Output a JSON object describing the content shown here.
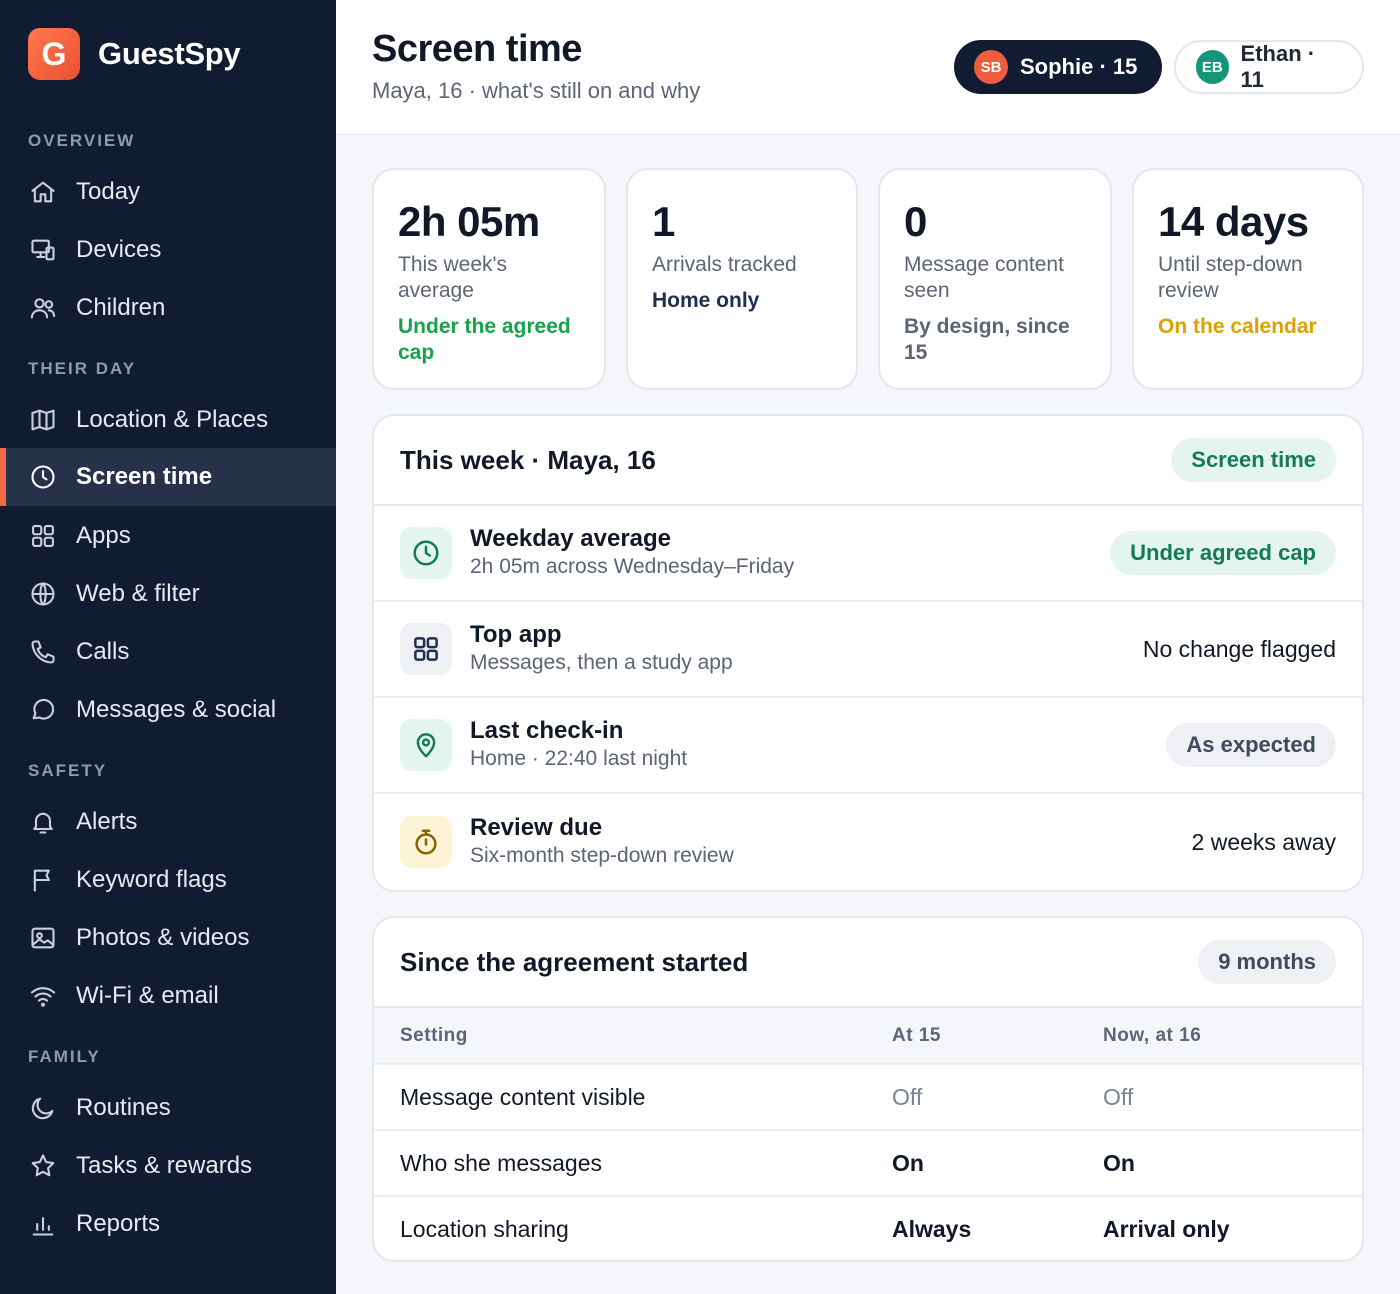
{
  "app": {
    "logo_letter": "G",
    "name": "GuestSpy",
    "accent": "#f26b45"
  },
  "nav": {
    "sections": [
      "OVERVIEW",
      "THEIR DAY",
      "SAFETY",
      "FAMILY"
    ],
    "items": [
      {
        "label": "Today",
        "icon": "home-icon"
      },
      {
        "label": "Devices",
        "icon": "devices-icon"
      },
      {
        "label": "Children",
        "icon": "users-icon"
      },
      {
        "label": "Location & Places",
        "icon": "map-icon"
      },
      {
        "label": "Screen time",
        "icon": "clock-icon",
        "active": true
      },
      {
        "label": "Apps",
        "icon": "apps-icon"
      },
      {
        "label": "Web & filter",
        "icon": "globe-icon"
      },
      {
        "label": "Calls",
        "icon": "phone-icon"
      },
      {
        "label": "Messages & social",
        "icon": "chat-icon"
      },
      {
        "label": "Alerts",
        "icon": "bell-icon"
      },
      {
        "label": "Keyword flags",
        "icon": "flag-icon"
      },
      {
        "label": "Photos & videos",
        "icon": "image-icon"
      },
      {
        "label": "Wi-Fi & email",
        "icon": "wifi-icon"
      },
      {
        "label": "Routines",
        "icon": "moon-icon"
      },
      {
        "label": "Tasks & rewards",
        "icon": "star-icon"
      },
      {
        "label": "Reports",
        "icon": "bar-chart-icon"
      }
    ]
  },
  "header": {
    "title": "Screen time",
    "subtitle": "Maya, 16 · what's still on and why",
    "children": [
      {
        "initials": "SB",
        "label": "Sophie · 15",
        "selected": true
      },
      {
        "initials": "EB",
        "label": "Ethan · 11",
        "selected": false
      }
    ]
  },
  "stats": [
    {
      "value": "2h 05m",
      "label": "This week's average",
      "note": "Under the agreed cap",
      "note_color": "#16a34a"
    },
    {
      "value": "1",
      "label": "Arrivals tracked",
      "note": "Home only",
      "note_color": "#1f2f4d"
    },
    {
      "value": "0",
      "label": "Message content seen",
      "note": "By design, since 15",
      "note_color": "#5b6577"
    },
    {
      "value": "14 days",
      "label": "Until step-down review",
      "note": "On the calendar",
      "note_color": "#e0a100"
    }
  ],
  "week": {
    "title": "This week · Maya, 16",
    "tag": "Screen time",
    "rows": [
      {
        "icon": "clock-icon",
        "title": "Weekday average",
        "sub": "2h 05m across Wednesday–Friday",
        "right": "Under agreed cap",
        "right_style": "green-badge"
      },
      {
        "icon": "apps-icon",
        "title": "Top app",
        "sub": "Messages, then a study app",
        "right": "No change flagged",
        "right_style": "text"
      },
      {
        "icon": "location-pin-icon",
        "title": "Last check-in",
        "sub": "Home · 22:40 last night",
        "right": "As expected",
        "right_style": "gray-badge"
      },
      {
        "icon": "timer-icon",
        "title": "Review due",
        "sub": "Six-month step-down review",
        "right": "2 weeks away",
        "right_style": "text"
      }
    ]
  },
  "agreement": {
    "title": "Since the agreement started",
    "tag": "9 months",
    "columns": [
      "Setting",
      "At 15",
      "Now, at 16"
    ],
    "rows": [
      {
        "setting": "Message content visible",
        "at15": "Off",
        "now": "Off"
      },
      {
        "setting": "Who she messages",
        "at15": "On",
        "now": "On"
      },
      {
        "setting": "Location sharing",
        "at15": "Always",
        "now": "Arrival only"
      }
    ]
  }
}
